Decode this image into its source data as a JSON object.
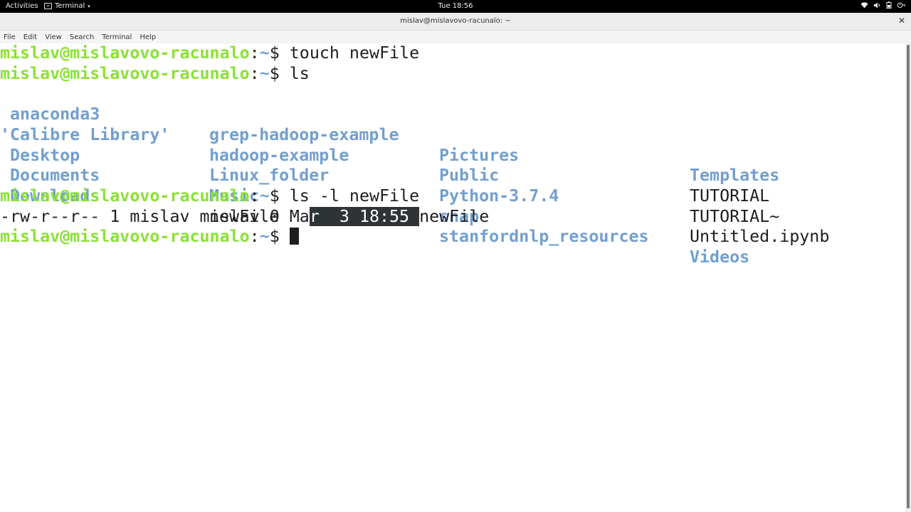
{
  "topbar": {
    "activities": "Activities",
    "app_name": "Terminal",
    "clock": "Tue 18:56",
    "status_icons": [
      "wifi-icon",
      "volume-icon",
      "battery-icon",
      "power-icon"
    ]
  },
  "window": {
    "title": "mislav@mislavovo-racunalo: ~",
    "close": "✕"
  },
  "menubar": {
    "items": [
      "File",
      "Edit",
      "View",
      "Search",
      "Terminal",
      "Help"
    ]
  },
  "terminal": {
    "prompt_user": "mislav@mislavovo-racunalo",
    "prompt_sep": ":",
    "prompt_path": "~",
    "prompt_symbol": "$",
    "commands": [
      "touch newFile",
      "ls",
      "ls -l newFile"
    ],
    "ls_output": {
      "col1": [
        " anaconda3",
        "'Calibre Library'",
        " Desktop",
        " Documents",
        " Downloads"
      ],
      "col2": [
        "grep-hadoop-example",
        "hadoop-example",
        "Linux_folder",
        "Music",
        "newFile"
      ],
      "col3": [
        "Pictures",
        "Public",
        "Python-3.7.4",
        "snap",
        "stanfordnlp_resources"
      ],
      "col4": [
        "Templates",
        "TUTORIAL",
        "TUTORIAL~",
        "Untitled.ipynb",
        "Videos"
      ]
    },
    "ls_l_output": {
      "before_selection": "-rw-r--r-- 1 mislav mislav 0 Ma",
      "selected": "r  3 18:55 ",
      "after_selection": "newFile"
    }
  },
  "colors": {
    "prompt": "#8ae234",
    "directory": "#729fcf",
    "text": "#1e1e1e",
    "selection": "#2e3436"
  }
}
